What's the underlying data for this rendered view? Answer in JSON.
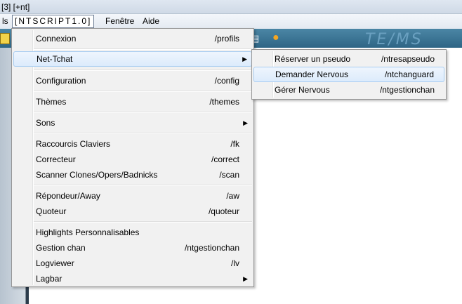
{
  "window": {
    "title": "[3] [+nt]"
  },
  "menubar": {
    "items": [
      {
        "label": "ls"
      },
      {
        "label": "[NTSCRIPT1.0]"
      },
      {
        "label": "Fenêtre"
      },
      {
        "label": "Aide"
      }
    ]
  },
  "toolbar": {
    "logo_text": "TE/MS"
  },
  "menu": {
    "items": [
      {
        "label": "Connexion",
        "command": "/profils"
      },
      {
        "label": "Net-Tchat",
        "command": ""
      },
      {
        "label": "Configuration",
        "command": "/config"
      },
      {
        "label": "Thèmes",
        "command": "/themes"
      },
      {
        "label": "Sons",
        "command": ""
      },
      {
        "label": "Raccourcis Claviers",
        "command": "/fk"
      },
      {
        "label": "Correcteur",
        "command": "/correct"
      },
      {
        "label": "Scanner Clones/Opers/Badnicks",
        "command": "/scan"
      },
      {
        "label": "Répondeur/Away",
        "command": "/aw"
      },
      {
        "label": "Quoteur",
        "command": "/quoteur"
      },
      {
        "label": "Highlights Personnalisables",
        "command": ""
      },
      {
        "label": "Gestion chan",
        "command": "/ntgestionchan"
      },
      {
        "label": "Logviewer",
        "command": "/lv"
      },
      {
        "label": "Lagbar",
        "command": ""
      }
    ],
    "submenu_arrow": "▶"
  },
  "submenu": {
    "items": [
      {
        "label": "Réserver un pseudo",
        "command": "/ntresapseudo"
      },
      {
        "label": "Demander Nervous",
        "command": "/ntchanguard"
      },
      {
        "label": "Gérer Nervous",
        "command": "/ntgestionchan"
      }
    ]
  },
  "colors": {
    "toolbar": "#3a7597",
    "highlight": "#dcebfc",
    "highlight_border": "#a8cdf1",
    "menu_bg": "#f1f1f1"
  }
}
